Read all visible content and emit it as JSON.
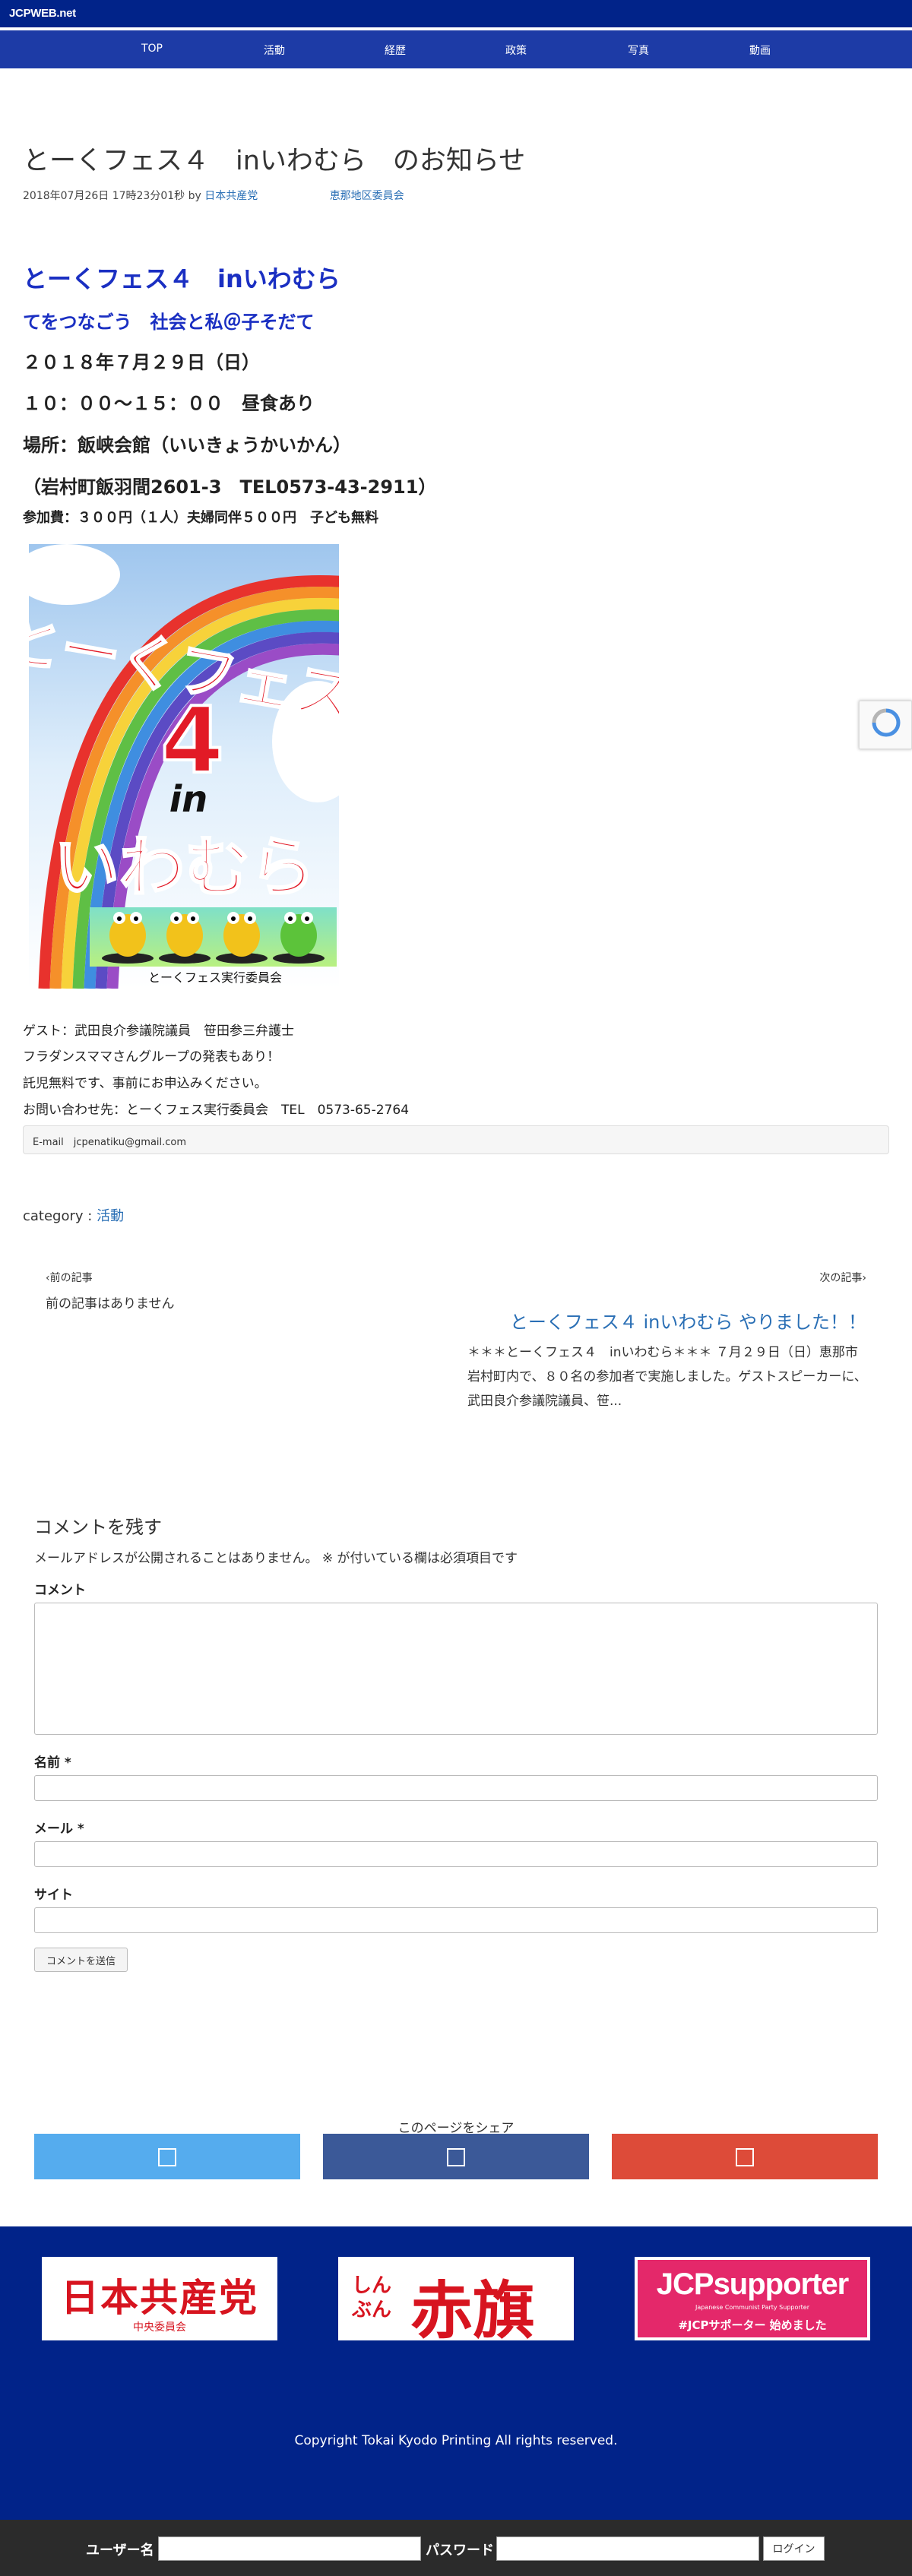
{
  "site_name": "JCPWEB.net",
  "nav": [
    "TOP",
    "活動",
    "経歴",
    "政策",
    "写真",
    "動画"
  ],
  "post": {
    "title": "とーくフェス４　inいわむら　のお知らせ",
    "date": "2018年07月26日 17時23分01秒",
    "by": "by",
    "author": "日本共産党",
    "category": "恵那地区委員会"
  },
  "event": {
    "title": "とーくフェス４　inいわむら",
    "subtitle": "てをつなごう　社会と私＠子そだて",
    "date": "２０１８年７月２９日（日）",
    "time": "１０：００〜１５：００　昼食あり",
    "place": "場所：飯峡会館（いいきょうかいかん）",
    "address": "（岩村町飯羽間2601-3　TEL0573-43-2911）",
    "fee": "参加費：３００円（１人）夫婦同伴５００円　子ども無料"
  },
  "poster": {
    "line1": "とーくフェス",
    "number": "4",
    "in": "in",
    "place": "いわむら",
    "committee": "とーくフェス実行委員会"
  },
  "details": [
    "ゲスト：武田良介参議院議員　笹田参三弁護士",
    "フラダンスママさんグループの発表もあり！",
    "託児無料です、事前にお申込みください。",
    "お問い合わせ先：とーくフェス実行委員会　TEL　0573-65-2764"
  ],
  "email_box": "E-mail　jcpenatiku@gmail.com",
  "category_label": "category :",
  "category_link": "活動",
  "prev_label": "前の記事",
  "prev_none": "前の記事はありません",
  "next_label": "次の記事",
  "next_title": "とーくフェス４ inいわむら やりました！！",
  "next_excerpt": "＊＊＊とーくフェス４　inいわむら＊＊＊ ７月２９日（日）恵那市岩村町内で、８０名の参加者で実施しました。ゲストスピーカーに、武田良介参議院議員、笹...",
  "comment": {
    "heading": "コメントを残す",
    "note": "メールアドレスが公開されることはありません。 ※ が付いている欄は必須項目です",
    "comment_label": "コメント",
    "name_label": "名前 *",
    "mail_label": "メール *",
    "site_label": "サイト",
    "submit": "コメントを送信"
  },
  "share": {
    "heading": "このページをシェア",
    "colors": [
      "#55acee",
      "#3b5998",
      "#dd4b39"
    ]
  },
  "banners": {
    "jcp_main": "日本共産党",
    "jcp_sub": "中央委員会",
    "akahata_kana": "しんぶん",
    "akahata": "赤旗",
    "supporter": "JCPsupporter",
    "supporter_small": "Japanese Communist Party Supporter",
    "supporter_sub": "#JCPサポーター 始めました"
  },
  "copyright": "Copyright Tokai Kyodo Printing All rights reserved.",
  "login": {
    "user_label": "ユーザー名",
    "pass_label": "パスワード",
    "button": "ログイン"
  },
  "colors": {
    "header": "#012389",
    "nav": "#1d3ba6",
    "link": "#2a6fb5",
    "event_title": "#1a2fc2"
  }
}
